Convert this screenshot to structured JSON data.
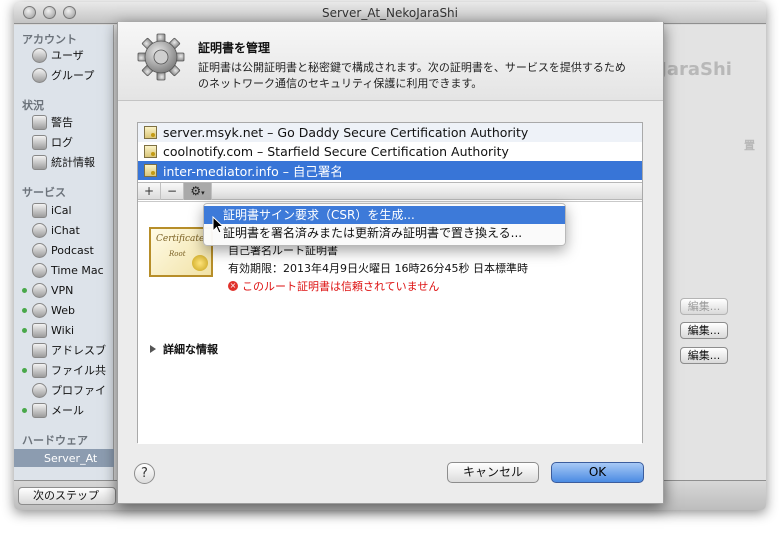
{
  "window": {
    "title": "Server_At_NekoJaraShi",
    "ghost_title": "NekoJaraShi",
    "ghost_col_header": "置"
  },
  "sidebar": {
    "sections": [
      {
        "label": "アカウント",
        "items": [
          {
            "label": "ユーザ",
            "icon": "user-icon"
          },
          {
            "label": "グループ",
            "icon": "group-icon"
          }
        ]
      },
      {
        "label": "状況",
        "items": [
          {
            "label": "警告",
            "icon": "alert-icon"
          },
          {
            "label": "ログ",
            "icon": "log-icon"
          },
          {
            "label": "統計情報",
            "icon": "stats-icon"
          }
        ]
      },
      {
        "label": "サービス",
        "items": [
          {
            "label": "iCal",
            "icon": "calendar-icon",
            "active": false
          },
          {
            "label": "iChat",
            "icon": "chat-icon",
            "active": false
          },
          {
            "label": "Podcast",
            "icon": "podcast-icon",
            "active": false
          },
          {
            "label": "Time Mac",
            "icon": "time-machine-icon",
            "active": false
          },
          {
            "label": "VPN",
            "icon": "vpn-icon",
            "active": true
          },
          {
            "label": "Web",
            "icon": "web-icon",
            "active": true
          },
          {
            "label": "Wiki",
            "icon": "wiki-icon",
            "active": true
          },
          {
            "label": "アドレスブ",
            "icon": "address-book-icon",
            "active": false
          },
          {
            "label": "ファイル共",
            "icon": "file-sharing-icon",
            "active": true
          },
          {
            "label": "プロファイ",
            "icon": "profile-icon",
            "active": false
          },
          {
            "label": "メール",
            "icon": "mail-icon",
            "active": true
          }
        ]
      },
      {
        "label": "ハードウェア",
        "items": [
          {
            "label": "Server_At",
            "icon": "server-icon",
            "selected": true
          }
        ]
      }
    ]
  },
  "main": {
    "edit_buttons": [
      "編集...",
      "編集...",
      "編集..."
    ],
    "next_step_label": "次のステップ"
  },
  "sheet": {
    "title": "証明書を管理",
    "description": "証明書は公開証明書と秘密鍵で構成されます。次の証明書を、サービスを提供するためのネットワーク通信のセキュリティ保護に利用できます。",
    "certificates": [
      {
        "label": "server.msyk.net – Go Daddy Secure Certification Authority"
      },
      {
        "label": "coolnotify.com – Starfield Secure Certification Authority"
      },
      {
        "label": "inter-mediator.info – 自己署名"
      }
    ],
    "toolbar": {
      "add": "+",
      "remove": "−",
      "action": "⚙"
    },
    "detail": {
      "image_text_1": "Certificate",
      "image_text_2": "Root",
      "name_partial": "自己署名ルート証明書",
      "expiry": "有効期限：2013年4月9日火曜日 16時26分45秒 日本標準時",
      "warning": "このルート証明書は信頼されていません",
      "details_label": "詳細な情報"
    },
    "help_label": "?",
    "cancel_label": "キャンセル",
    "ok_label": "OK"
  },
  "context_menu": {
    "items": [
      {
        "label": "証明書サイン要求（CSR）を生成...",
        "highlighted": true
      },
      {
        "label": "証明書を署名済みまたは更新済み証明書で置き換える...",
        "highlighted": false
      }
    ]
  },
  "colors": {
    "selection_blue": "#3875d7",
    "ok_button": "#4b8be3",
    "warning_red": "#d11111",
    "status_green": "#49a84a"
  }
}
